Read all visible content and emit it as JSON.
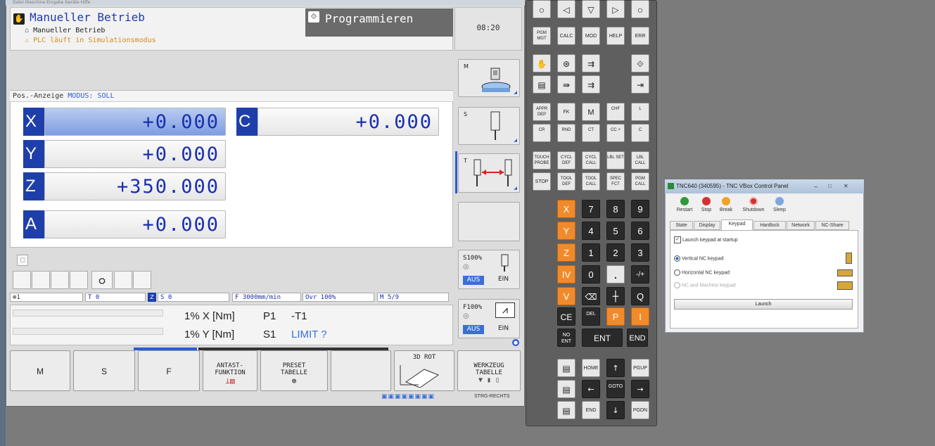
{
  "menu_bar": "Datei   Maschine   Eingabe   Geräte   Hilfe",
  "mode": {
    "title": "Manueller Betrieb",
    "sub1": "Manueller Betrieb",
    "sub2": "PLC läuft in Simulationsmodus",
    "program_label": "Programmieren",
    "clock": "08:20"
  },
  "pos_display": {
    "header_label": "Pos.-Anzeige",
    "header_mode": "MODUS: SOLL",
    "axes": [
      {
        "letter": "X",
        "value": "+0.000"
      },
      {
        "letter": "Y",
        "value": "+0.000"
      },
      {
        "letter": "Z",
        "value": "+350.000"
      },
      {
        "letter": "A",
        "value": "+0.000"
      },
      {
        "letter": "C",
        "value": "+0.000"
      }
    ]
  },
  "status_line": {
    "tool": "T 0",
    "spindle": "S 0",
    "feed": "F 3000mm/min",
    "override": "Ovr 100%",
    "mfunc": "M 5/9"
  },
  "load": [
    {
      "pct": "1% X [Nm]",
      "p": "P1",
      "v": "-T1"
    },
    {
      "pct": "1% Y [Nm]",
      "p": "S1",
      "v": "LIMIT ?"
    }
  ],
  "side_keys": {
    "m": "M",
    "s": "S",
    "t": "T",
    "s_override": "S100%",
    "f_override": "F100%",
    "aus": "AUS",
    "ein": "EIN"
  },
  "softkeys": [
    "M",
    "S",
    "F",
    "ANTAST-\nFUNKTION",
    "PRESET\nTABELLE",
    "",
    "3D ROT",
    "WERKZEUG\nTABELLE"
  ],
  "taskbar": "STRG-RECHTS",
  "keypad": {
    "row1": [
      "○",
      "◁",
      "▽",
      "▷",
      "○"
    ],
    "row2": [
      "PGM MGT",
      "CALC",
      "MOD",
      "HELP",
      "ERR"
    ],
    "cycle1": [
      "APPR DEP",
      "FK",
      "M",
      "CHF",
      "L"
    ],
    "cycle2": [
      "CR",
      "RND",
      "CT",
      "CC +",
      "C"
    ],
    "cycle3": [
      "TOUCH PROBE",
      "CYCL DEF",
      "CYCL CALL",
      "LBL SET",
      "LBL CALL"
    ],
    "cycle4": [
      "STOP",
      "TOOL DEF",
      "TOOL CALL",
      "SPEC FCT",
      "PGM CALL"
    ],
    "axes": [
      "X",
      "Y",
      "Z",
      "IV",
      "V"
    ],
    "num": [
      [
        "7",
        "8",
        "9"
      ],
      [
        "4",
        "5",
        "6"
      ],
      [
        "1",
        "2",
        "3"
      ],
      [
        "0",
        ".",
        "-/+"
      ]
    ],
    "row_ce": [
      "CE",
      "DEL",
      "P",
      "I"
    ],
    "noent": "NO ENT",
    "ent": "ENT",
    "end": "END",
    "home": "HOME",
    "pgup": "PGUP",
    "goto": "GOTO",
    "endk": "END",
    "pgdn": "PGDN",
    "q": "Q"
  },
  "control_panel": {
    "title": "TNC640 (340595) - TNC VBox Control Panel",
    "buttons": [
      "Restart",
      "Stop",
      "Break",
      "Shutdown",
      "Sleep"
    ],
    "tabs": [
      "State",
      "Display",
      "Keypad",
      "Hardlock",
      "Network",
      "NC-Share"
    ],
    "checkbox": "Launch keypad at startup",
    "options": [
      "Vertical NC keypad",
      "Horizontal NC keypad",
      "NC and Machine keypad"
    ],
    "launch": "Launch"
  }
}
